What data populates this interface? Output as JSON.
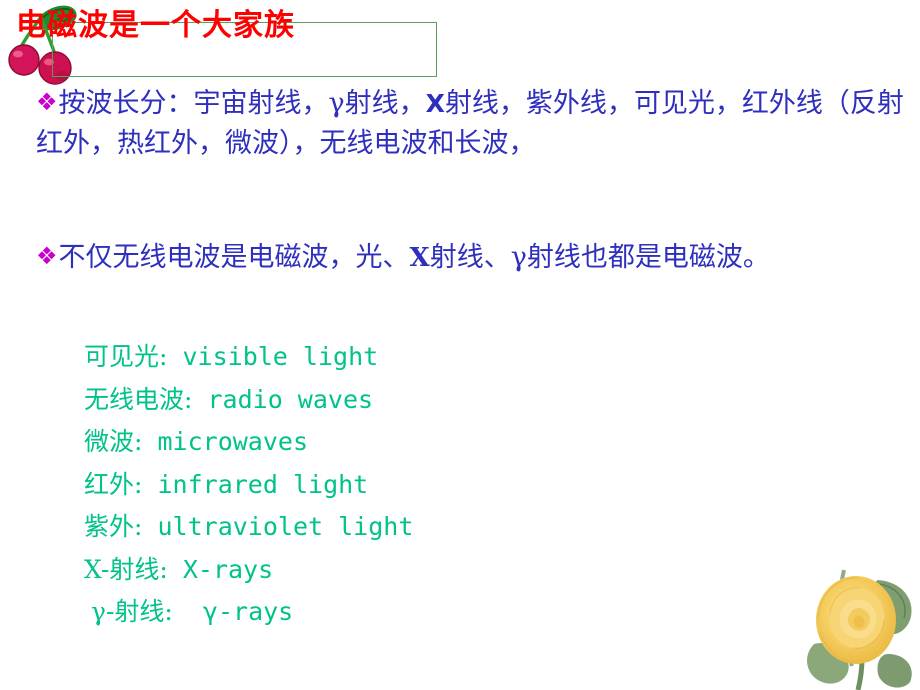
{
  "slide": {
    "title": "电磁波是一个大家族",
    "title_color": "#ff0000",
    "title_border_color": "#5aa05a",
    "body_color": "#2f2fbe",
    "bullet_color": "#cc00cc",
    "vocab_color": "#00c28a",
    "background_color": "#ffffff"
  },
  "bullets": [
    {
      "marker": "❖",
      "lines": [
        "按波长分：宇宙射线，γ射线，",
        "射线，紫外线，",
        "可见光，红外线（反射红外，热红外，微波），",
        "无线电波和长波，"
      ],
      "inline_bold_1": "X",
      "full_text": "❖按波长分：宇宙射线，γ射线，X射线，紫外线，可见光，红外线（反射红外，热红外，微波），无线电波和长波，"
    },
    {
      "marker": "❖",
      "lines": [
        "不仅无线电波是电磁波，光、",
        "射线、γ射线也",
        "都是电磁波。"
      ],
      "inline_bold_1": "X",
      "full_text": "❖不仅无线电波是电磁波，光、X射线、γ射线也都是电磁波。"
    }
  ],
  "vocabulary": [
    {
      "cn": "可见光:",
      "en": "visible light"
    },
    {
      "cn": "无线电波:",
      "en": "radio waves"
    },
    {
      "cn": "微波:",
      "en": "microwaves"
    },
    {
      "cn": "红外:",
      "en": "infrared light"
    },
    {
      "cn": "紫外:",
      "en": "ultraviolet light"
    },
    {
      "cn": "X-射线:",
      "en": "X-rays"
    },
    {
      "cn": "γ-射线:",
      "en": "γ-rays"
    }
  ],
  "decorations": {
    "cherry": "cherries-clipart",
    "rose": "yellow-rose-photo"
  }
}
